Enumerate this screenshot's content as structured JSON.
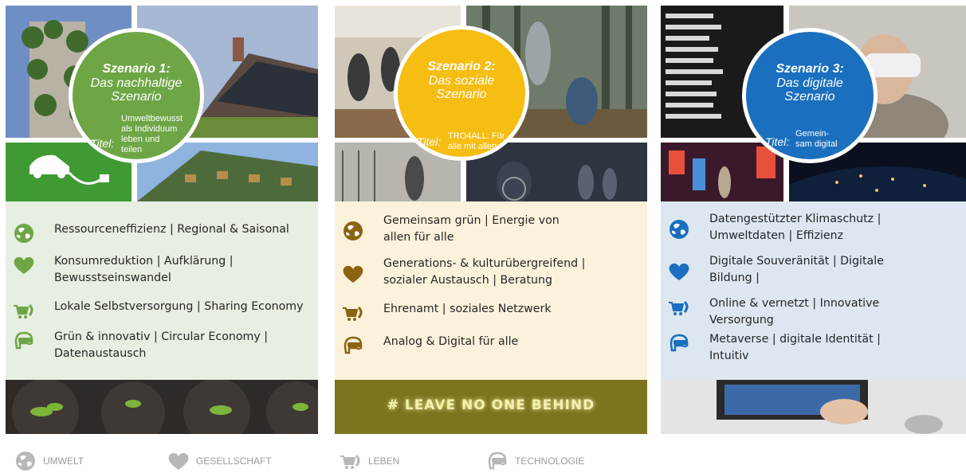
{
  "colors": {
    "green": "#6ea646",
    "yellow": "#f6bd13",
    "blue": "#1a6fbe",
    "brown": "#8a6410",
    "gray": "#b8b8b8"
  },
  "scenarios": [
    {
      "title": "Szenario 1:",
      "subtitle_1": "Das nachhaltige",
      "subtitle_2": "Szenario",
      "titel_label": "Titel:",
      "titel_1": "Umweltbewusst",
      "titel_2": "als Individuum",
      "titel_3": "leben und",
      "titel_4": "teilen",
      "features": [
        {
          "icon": "globe-icon",
          "line1": "Ressourceneffizienz | Regional & Saisonal",
          "line2": ""
        },
        {
          "icon": "heart-icon",
          "line1": "Konsumreduktion | Aufklärung |",
          "line2": "Bewusstseinswandel"
        },
        {
          "icon": "cart-icon",
          "line1": "Lokale Selbstversorgung | Sharing Economy",
          "line2": ""
        },
        {
          "icon": "vr-headset-icon",
          "line1": "Grün & innovativ | Circular Economy |",
          "line2": "Datenaustausch"
        }
      ]
    },
    {
      "title": "Szenario 2:",
      "subtitle_1": "Das soziale",
      "subtitle_2": "Szenario",
      "titel_label": "Titel:",
      "titel_1": "TRO4ALL: Für",
      "titel_2": "alle mit allen",
      "features": [
        {
          "icon": "globe-icon",
          "line1": "Gemeinsam grün | Energie von",
          "line2": "allen für alle"
        },
        {
          "icon": "heart-icon",
          "line1": "Generations- & kulturübergreifend |",
          "line2": "sozialer Austausch | Beratung"
        },
        {
          "icon": "cart-icon",
          "line1": "Ehrenamt | soziales Netzwerk",
          "line2": ""
        },
        {
          "icon": "vr-headset-icon",
          "line1": "Analog & Digital für alle",
          "line2": ""
        }
      ],
      "banner": "# LEAVE NO ONE BEHIND"
    },
    {
      "title": "Szenario 3:",
      "subtitle_1": "Das digitale",
      "subtitle_2": "Szenario",
      "titel_label": "Titel:",
      "titel_1": "Gemein-",
      "titel_2": "sam digital",
      "features": [
        {
          "icon": "globe-icon",
          "line1": "Datengestützter Klimaschutz |",
          "line2": "Umweltdaten | Effizienz"
        },
        {
          "icon": "heart-icon",
          "line1": "Digitale Souveränität | Digitale",
          "line2": "Bildung |"
        },
        {
          "icon": "cart-icon",
          "line1": "Online & vernetzt | Innovative",
          "line2": "Versorgung"
        },
        {
          "icon": "vr-headset-icon",
          "line1": "Metaverse | digitale Identität |",
          "line2": "Intuitiv"
        }
      ]
    }
  ],
  "legend": [
    {
      "icon": "globe-icon",
      "label": "UMWELT"
    },
    {
      "icon": "heart-icon",
      "label": "GESELLSCHAFT"
    },
    {
      "icon": "cart-icon",
      "label": "LEBEN"
    },
    {
      "icon": "vr-headset-icon",
      "label": "TECHNOLOGIE"
    }
  ]
}
